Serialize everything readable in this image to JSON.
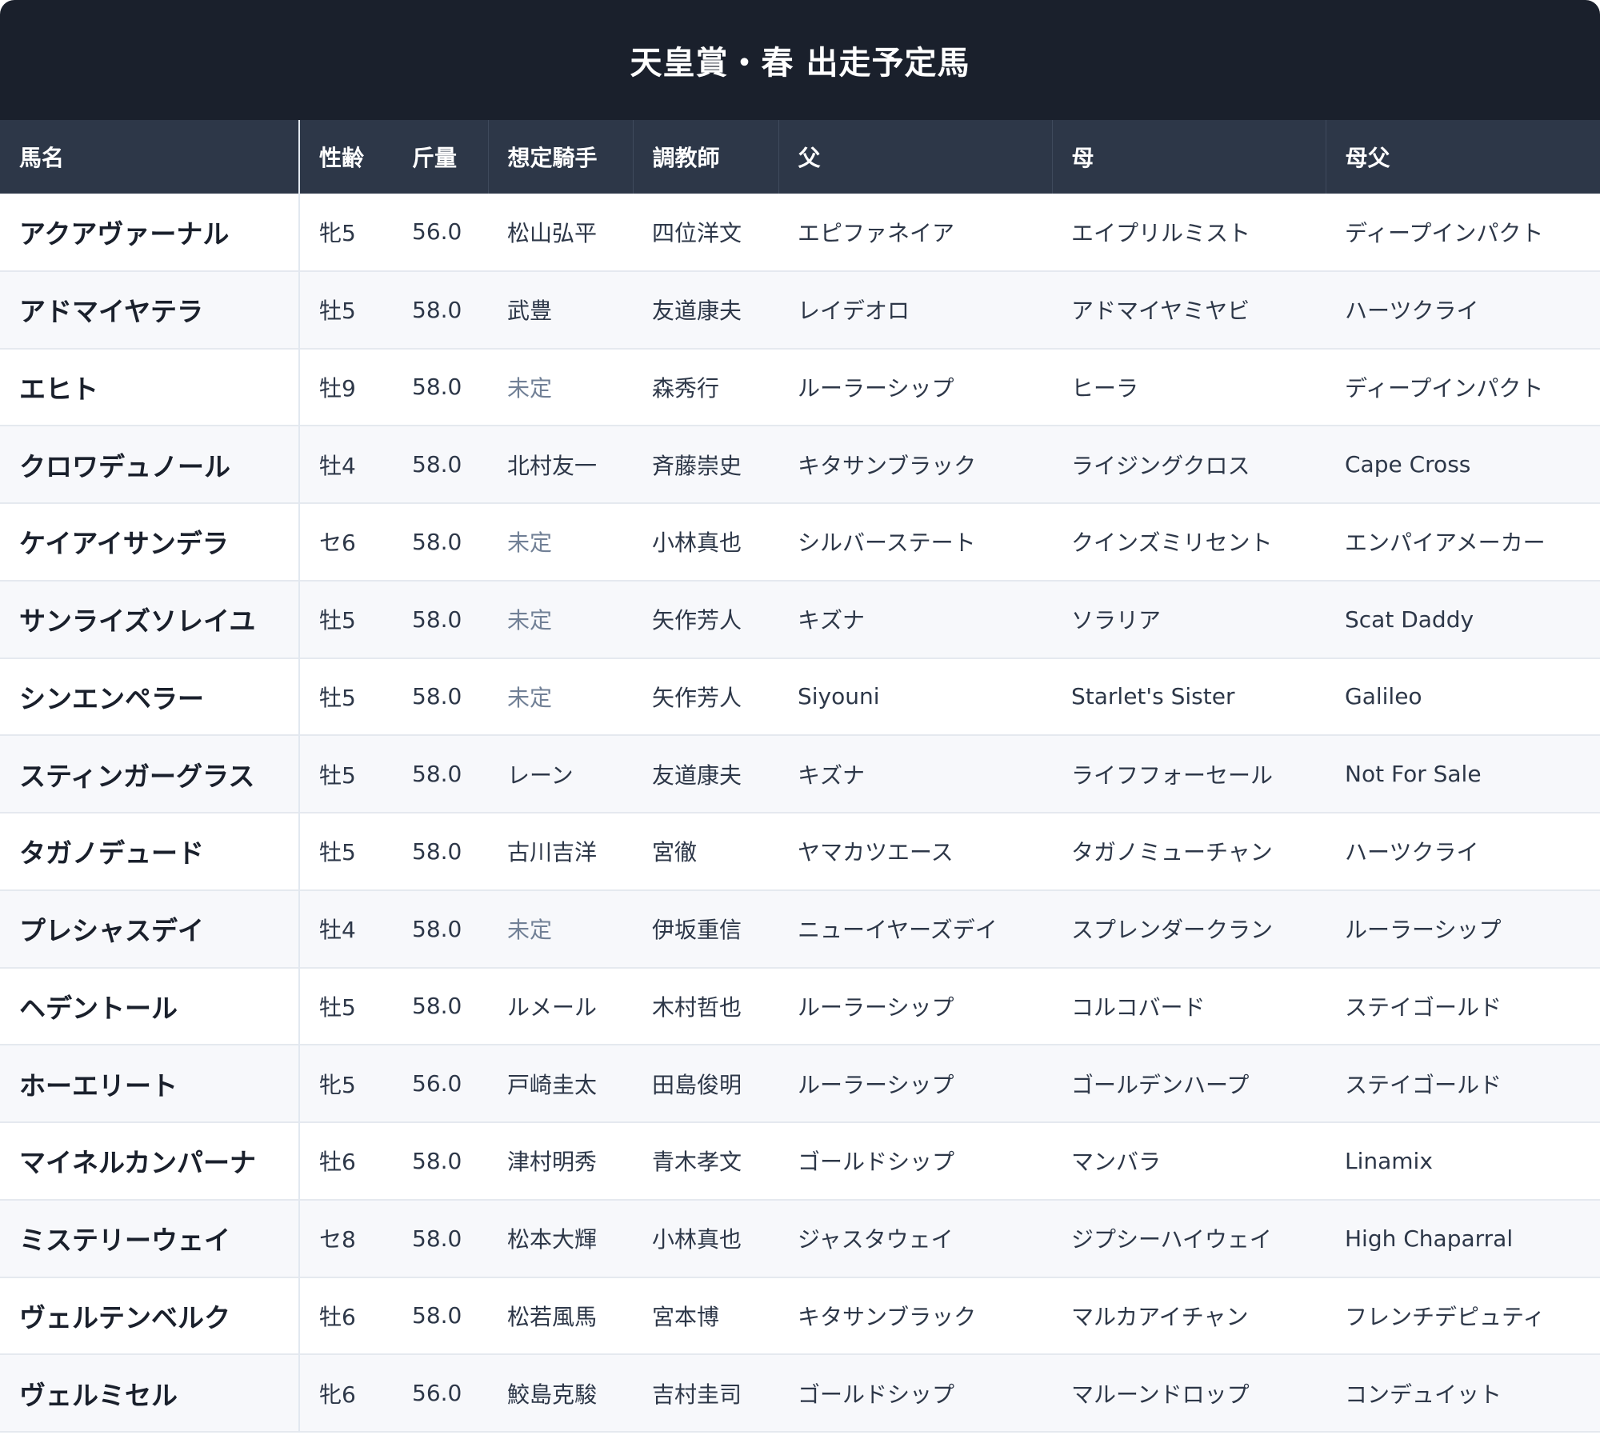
{
  "title": "天皇賞・春 出走予定馬",
  "columns": {
    "name": "馬名",
    "sex_age": "性齢",
    "weight": "斤量",
    "jockey": "想定騎手",
    "trainer": "調教師",
    "sire": "父",
    "dam": "母",
    "broodmare_sire": "母父"
  },
  "colors": {
    "title_bg": "#1a202c",
    "header_bg": "#2d3748",
    "undecided_text": "#718096",
    "row_alt": "#f7f8fb"
  },
  "rows": [
    {
      "name": "アクアヴァーナル",
      "sex_age": "牝5",
      "weight": "56.0",
      "jockey": "松山弘平",
      "trainer": "四位洋文",
      "sire": "エピファネイア",
      "dam": "エイプリルミスト",
      "broodmare_sire": "ディープインパクト"
    },
    {
      "name": "アドマイヤテラ",
      "sex_age": "牡5",
      "weight": "58.0",
      "jockey": "武豊",
      "trainer": "友道康夫",
      "sire": "レイデオロ",
      "dam": "アドマイヤミヤビ",
      "broodmare_sire": "ハーツクライ"
    },
    {
      "name": "エヒト",
      "sex_age": "牡9",
      "weight": "58.0",
      "jockey": "未定",
      "trainer": "森秀行",
      "sire": "ルーラーシップ",
      "dam": "ヒーラ",
      "broodmare_sire": "ディープインパクト"
    },
    {
      "name": "クロワデュノール",
      "sex_age": "牡4",
      "weight": "58.0",
      "jockey": "北村友一",
      "trainer": "斉藤崇史",
      "sire": "キタサンブラック",
      "dam": "ライジングクロス",
      "broodmare_sire": "Cape Cross"
    },
    {
      "name": "ケイアイサンデラ",
      "sex_age": "セ6",
      "weight": "58.0",
      "jockey": "未定",
      "trainer": "小林真也",
      "sire": "シルバーステート",
      "dam": "クインズミリセント",
      "broodmare_sire": "エンパイアメーカー"
    },
    {
      "name": "サンライズソレイユ",
      "sex_age": "牡5",
      "weight": "58.0",
      "jockey": "未定",
      "trainer": "矢作芳人",
      "sire": "キズナ",
      "dam": "ソラリア",
      "broodmare_sire": "Scat Daddy"
    },
    {
      "name": "シンエンペラー",
      "sex_age": "牡5",
      "weight": "58.0",
      "jockey": "未定",
      "trainer": "矢作芳人",
      "sire": "Siyouni",
      "dam": "Starlet's Sister",
      "broodmare_sire": "Galileo"
    },
    {
      "name": "スティンガーグラス",
      "sex_age": "牡5",
      "weight": "58.0",
      "jockey": "レーン",
      "trainer": "友道康夫",
      "sire": "キズナ",
      "dam": "ライフフォーセール",
      "broodmare_sire": "Not For Sale"
    },
    {
      "name": "タガノデュード",
      "sex_age": "牡5",
      "weight": "58.0",
      "jockey": "古川吉洋",
      "trainer": "宮徹",
      "sire": "ヤマカツエース",
      "dam": "タガノミューチャン",
      "broodmare_sire": "ハーツクライ"
    },
    {
      "name": "プレシャスデイ",
      "sex_age": "牡4",
      "weight": "58.0",
      "jockey": "未定",
      "trainer": "伊坂重信",
      "sire": "ニューイヤーズデイ",
      "dam": "スプレンダークラン",
      "broodmare_sire": "ルーラーシップ"
    },
    {
      "name": "ヘデントール",
      "sex_age": "牡5",
      "weight": "58.0",
      "jockey": "ルメール",
      "trainer": "木村哲也",
      "sire": "ルーラーシップ",
      "dam": "コルコバード",
      "broodmare_sire": "ステイゴールド"
    },
    {
      "name": "ホーエリート",
      "sex_age": "牝5",
      "weight": "56.0",
      "jockey": "戸崎圭太",
      "trainer": "田島俊明",
      "sire": "ルーラーシップ",
      "dam": "ゴールデンハープ",
      "broodmare_sire": "ステイゴールド"
    },
    {
      "name": "マイネルカンパーナ",
      "sex_age": "牡6",
      "weight": "58.0",
      "jockey": "津村明秀",
      "trainer": "青木孝文",
      "sire": "ゴールドシップ",
      "dam": "マンバラ",
      "broodmare_sire": "Linamix"
    },
    {
      "name": "ミステリーウェイ",
      "sex_age": "セ8",
      "weight": "58.0",
      "jockey": "松本大輝",
      "trainer": "小林真也",
      "sire": "ジャスタウェイ",
      "dam": "ジプシーハイウェイ",
      "broodmare_sire": "High Chaparral"
    },
    {
      "name": "ヴェルテンベルク",
      "sex_age": "牡6",
      "weight": "58.0",
      "jockey": "松若風馬",
      "trainer": "宮本博",
      "sire": "キタサンブラック",
      "dam": "マルカアイチャン",
      "broodmare_sire": "フレンチデピュティ"
    },
    {
      "name": "ヴェルミセル",
      "sex_age": "牝6",
      "weight": "56.0",
      "jockey": "鮫島克駿",
      "trainer": "吉村圭司",
      "sire": "ゴールドシップ",
      "dam": "マルーンドロップ",
      "broodmare_sire": "コンデュイット"
    }
  ]
}
